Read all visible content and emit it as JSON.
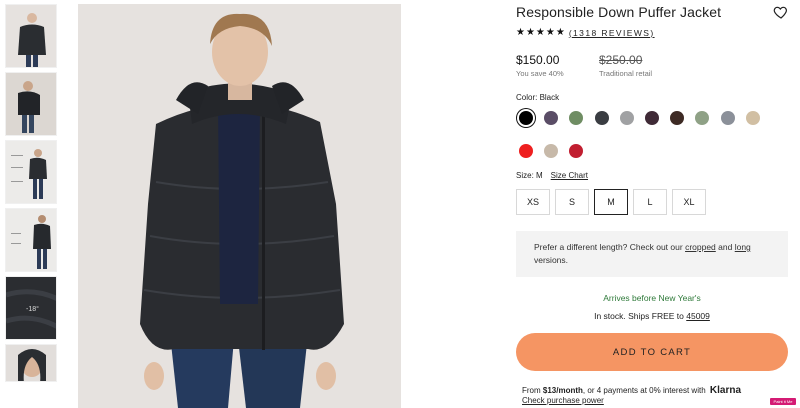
{
  "product": {
    "title": "Responsible Down Puffer Jacket",
    "stars": "★★★★★",
    "reviews": "(1318 REVIEWS)",
    "price": "$150.00",
    "savings": "You save 40%",
    "original_price": "$250.00",
    "original_label": "Traditional retail"
  },
  "color": {
    "label": "Color: Black",
    "swatches": [
      "#000000",
      "#5a4d66",
      "#6f8d63",
      "#3a3d42",
      "#a0a1a3",
      "#3f2a36",
      "#3d2a24",
      "#8fa186",
      "#8b9099",
      "#d1bfa3",
      "#ee1f1f",
      "#c7b9a9",
      "#c11e30"
    ],
    "selected_index": 0
  },
  "size": {
    "label": "Size: M",
    "chart_link": "Size Chart",
    "options": [
      "XS",
      "S",
      "M",
      "L",
      "XL"
    ],
    "selected": "M"
  },
  "length": {
    "text_before": "Prefer a different length? Check out our",
    "cropped": "cropped",
    "and": "and",
    "long": "long",
    "text_after": "versions."
  },
  "shipping": {
    "arrives": "Arrives before New Year's",
    "instock_prefix": "In stock. Ships FREE to",
    "zip": "45009"
  },
  "cart": {
    "button_label": "ADD TO CART"
  },
  "klarna": {
    "prefix": "From",
    "amount": "$13/month",
    "suffix": ", or 4 payments at 0% interest with",
    "brand": "Klarna",
    "check": "Check purchase power"
  },
  "badge": {
    "label": "Paint it Me"
  },
  "colors": {
    "accent": "#f59563",
    "arrives_green": "#2f7a3a"
  }
}
